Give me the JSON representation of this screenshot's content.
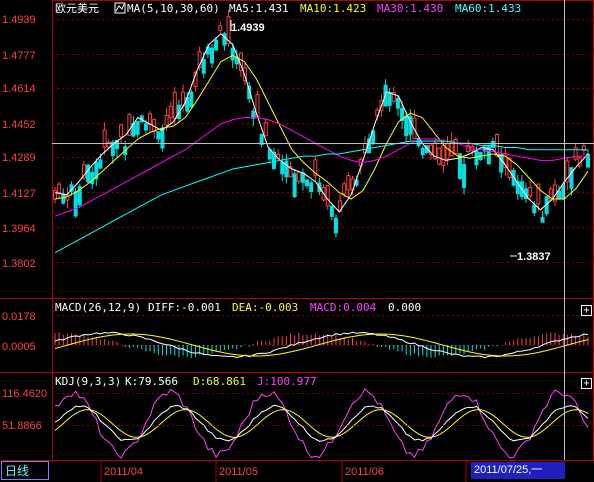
{
  "symbol": "欧元美元",
  "main_panel": {
    "ma_label": "MA(5,10,30,60)",
    "ma5": "MA5:1.431",
    "ma10": "MA10:1.423",
    "ma30": "MA30:1.430",
    "ma60": "MA60:1.433",
    "high_marker": "1.4939",
    "low_marker": "1.3837",
    "y_ticks": [
      "1.4939",
      "1.4777",
      "1.4614",
      "1.4452",
      "1.4289",
      "1.4127",
      "1.3964",
      "1.3802"
    ]
  },
  "macd_panel": {
    "label": "MACD(26,12,9)",
    "diff": "DIFF:-0.001",
    "dea": "DEA:-0.003",
    "macd": "MACD:0.004",
    "extra": "0.000",
    "y_ticks": [
      "0.0178",
      "0.0005"
    ]
  },
  "kdj_panel": {
    "label": "KDJ(9,3,3)",
    "k": "K:79.566",
    "d": "D:68.861",
    "j": "J:100.977",
    "y_ticks": [
      "116.4620",
      "51.8866"
    ]
  },
  "x_axis": {
    "period_tab": "日线",
    "months": [
      "2011/04",
      "2011/05",
      "2011/06"
    ],
    "cursor_date": "2011/07/25,一"
  },
  "colors": {
    "up": "#ff4040",
    "down": "#00e0e0",
    "ma5": "#ffffff",
    "ma10": "#ffff00",
    "ma30": "#ff00ff",
    "ma60": "#00ffff",
    "grid": "#b00000"
  },
  "chart_data": {
    "type": "line",
    "title": "欧元美元",
    "ylim": [
      1.3802,
      1.4939
    ],
    "series": [
      {
        "name": "MA5",
        "values": [
          1.413,
          1.412,
          1.418,
          1.425,
          1.431,
          1.436,
          1.44,
          1.448,
          1.445,
          1.442,
          1.446,
          1.455,
          1.47,
          1.482,
          1.487,
          1.482,
          1.468,
          1.45,
          1.434,
          1.428,
          1.424,
          1.422,
          1.418,
          1.41,
          1.404,
          1.412,
          1.428,
          1.445,
          1.46,
          1.458,
          1.446,
          1.436,
          1.43,
          1.428,
          1.429,
          1.431,
          1.434,
          1.433,
          1.426,
          1.418,
          1.41,
          1.405,
          1.41,
          1.418,
          1.425,
          1.431
        ]
      },
      {
        "name": "MA10",
        "values": [
          1.41,
          1.411,
          1.414,
          1.418,
          1.423,
          1.428,
          1.433,
          1.438,
          1.441,
          1.443,
          1.444,
          1.448,
          1.456,
          1.465,
          1.474,
          1.477,
          1.474,
          1.466,
          1.455,
          1.444,
          1.433,
          1.427,
          1.422,
          1.418,
          1.413,
          1.41,
          1.414,
          1.424,
          1.436,
          1.446,
          1.45,
          1.448,
          1.441,
          1.434,
          1.43,
          1.429,
          1.43,
          1.431,
          1.43,
          1.426,
          1.42,
          1.414,
          1.41,
          1.41,
          1.415,
          1.423
        ]
      },
      {
        "name": "MA30",
        "values": [
          1.402,
          1.404,
          1.406,
          1.409,
          1.412,
          1.415,
          1.418,
          1.421,
          1.424,
          1.427,
          1.43,
          1.433,
          1.437,
          1.441,
          1.445,
          1.447,
          1.448,
          1.448,
          1.447,
          1.445,
          1.442,
          1.439,
          1.436,
          1.433,
          1.43,
          1.428,
          1.427,
          1.428,
          1.43,
          1.433,
          1.436,
          1.438,
          1.438,
          1.437,
          1.436,
          1.434,
          1.433,
          1.432,
          1.431,
          1.43,
          1.429,
          1.428,
          1.428,
          1.429,
          1.43,
          1.43
        ]
      },
      {
        "name": "MA60",
        "values": [
          1.385,
          1.388,
          1.391,
          1.394,
          1.397,
          1.4,
          1.403,
          1.406,
          1.409,
          1.412,
          1.414,
          1.416,
          1.418,
          1.42,
          1.422,
          1.424,
          1.425,
          1.426,
          1.427,
          1.428,
          1.429,
          1.43,
          1.43,
          1.431,
          1.431,
          1.432,
          1.433,
          1.434,
          1.435,
          1.436,
          1.437,
          1.437,
          1.437,
          1.437,
          1.436,
          1.436,
          1.435,
          1.435,
          1.434,
          1.434,
          1.433,
          1.433,
          1.433,
          1.433,
          1.433,
          1.433
        ]
      }
    ]
  }
}
